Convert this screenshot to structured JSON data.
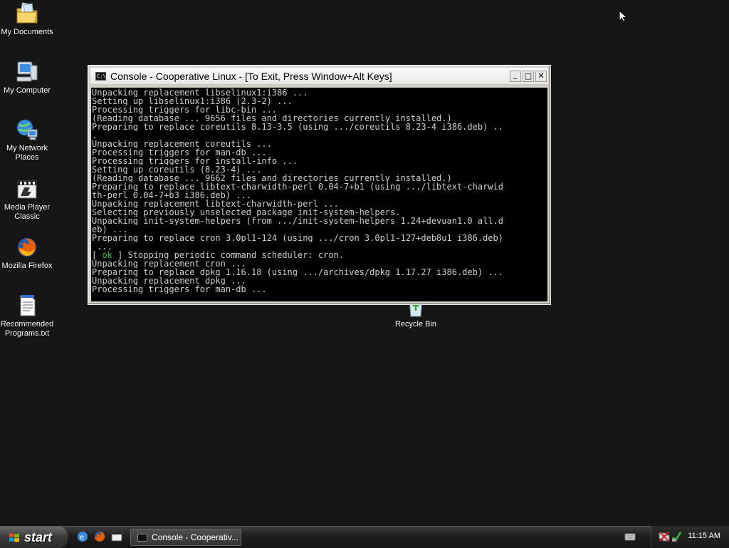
{
  "desktop": {
    "icons": [
      {
        "label": "My Documents",
        "icon": "folder-documents-icon"
      },
      {
        "label": "My Computer",
        "icon": "computer-icon"
      },
      {
        "label": "My Network\nPlaces",
        "icon": "network-places-icon"
      },
      {
        "label": "Media Player\nClassic",
        "icon": "media-player-icon"
      },
      {
        "label": "Mozilla Firefox",
        "icon": "firefox-icon"
      },
      {
        "label": "Recommended\nPrograms.txt",
        "icon": "text-file-icon"
      },
      {
        "label": "Recycle Bin",
        "icon": "recycle-bin-icon"
      }
    ]
  },
  "console": {
    "title": "Console - Cooperative Linux - [To Exit, Press Window+Alt Keys]",
    "minimize_label": "_",
    "maximize_label": "□",
    "close_label": "✕",
    "lines": [
      "Unpacking replacement libselinux1:i386 ...",
      "Setting up libselinux1:i386 (2.3-2) ...",
      "Processing triggers for libc-bin ...",
      "(Reading database ... 9656 files and directories currently installed.)",
      "Preparing to replace coreutils 8.13-3.5 (using .../coreutils_8.23-4_i386.deb) ..",
      ".",
      "Unpacking replacement coreutils ...",
      "Processing triggers for man-db ...",
      "Processing triggers for install-info ...",
      "Setting up coreutils (8.23-4) ...",
      "(Reading database ... 9662 files and directories currently installed.)",
      "Preparing to replace libtext-charwidth-perl 0.04-7+b1 (using .../libtext-charwid",
      "th-perl_0.04-7+b3_i386.deb) ...",
      "Unpacking replacement libtext-charwidth-perl ...",
      "Selecting previously unselected package init-system-helpers.",
      "Unpacking init-system-helpers (from .../init-system-helpers_1.24+devuan1.0_all.d",
      "eb) ...",
      "Preparing to replace cron 3.0pl1-124 (using .../cron_3.0pl1-127+deb8u1_i386.deb)",
      " ...",
      "",
      "Unpacking replacement cron ...",
      "Preparing to replace dpkg 1.16.18 (using .../archives/dpkg_1.17.27_i386.deb) ...",
      "Unpacking replacement dpkg ...",
      "Processing triggers for man-db ..."
    ],
    "ok_line": {
      "prefix": "[ ",
      "status": "ok",
      "suffix": " ] Stopping periodic command scheduler: cron."
    }
  },
  "taskbar": {
    "start_label": "start",
    "task_console_label": "Console - Cooperativ...",
    "clock": "11:15 AM"
  },
  "colors": {
    "desktop_bg": "#161616",
    "console_bg": "#000000",
    "console_text": "#d0d0d0",
    "ok_green": "#2fbf2f"
  }
}
